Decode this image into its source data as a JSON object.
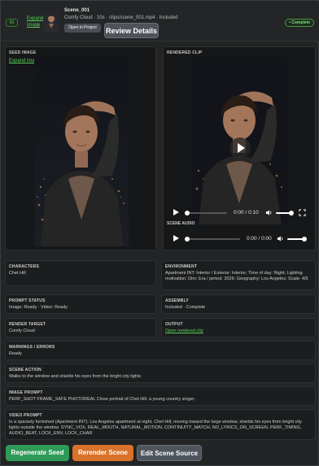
{
  "header": {
    "scene_number": "01",
    "expand_image_label": "Expand image",
    "scene_title": "Scene_001",
    "scene_meta": "Comfy Cloud · 10s · clips/scene_001.mp4 · Included",
    "open_in_project_label": "Open in Project",
    "review_details_label": "Review Details",
    "status_label": "• Complete"
  },
  "seed_panel": {
    "label": "SEED IMAGE",
    "expand_label": "Expand image"
  },
  "clip_panel": {
    "label": "RENDERED CLIP",
    "video_time": "0:00 / 0:10",
    "audio_label": "SCENE AUDIO",
    "audio_time": "0:00 / 0:00"
  },
  "cards": {
    "characters": {
      "title": "CHARACTERS",
      "body": "Chet Hill"
    },
    "environment": {
      "title": "ENVIRONMENT",
      "body": "Apartment INT: Interior / Exterior: Interior; Time of day: Night; Lighting motivation: Dim; Era / period: 2026; Geography: Los Angeles; Scale: 4/5"
    },
    "prompt_status": {
      "title": "PROMPT STATUS",
      "body": "Image: Ready · Video: Ready"
    },
    "assembly": {
      "title": "ASSEMBLY",
      "body": "Included · Complete"
    },
    "render_target": {
      "title": "RENDER TARGET",
      "body": "Comfy Cloud"
    },
    "output": {
      "title": "OUTPUT",
      "link": "Open rendered clip"
    },
    "warnings": {
      "title": "WARNINGS / ERRORS",
      "body": "Ready"
    },
    "scene_action": {
      "title": "SCENE ACTION",
      "body": "Walks to the window and shields his eyes from the bright city lights"
    },
    "image_prompt": {
      "title": "IMAGE PROMPT",
      "body": "PERF_SHOT FRAME_SAFE PHOTOREAL Close portrait of Chet Hill, a young country singer,"
    },
    "video_prompt": {
      "title": "VIDEO PROMPT",
      "body": "In a sparsely furnished (Apartment INT): Los Angeles apartment at night, Chet Hill, moving toward the large window, shields his eyes from bright city lights outside the window. SYNC_VOX, REAL_MOUTH, NATURAL_MOTION, CONTINUITY_MATCH, NO_LYRICS_ON_SCREEN, PERF_TIMING, AUDIO_BEAT, LOCK_ENV, LOCK_CHAR"
    }
  },
  "actions": {
    "regenerate_seed": "Regenerate Seed",
    "rerender_scene": "Rerender Scene",
    "edit_scene_source": "Edit Scene Source"
  },
  "colors": {
    "accent_green": "#59d159",
    "regenerate": "#2f9a57",
    "rerender": "#d9722a",
    "edit": "#4f555c"
  }
}
